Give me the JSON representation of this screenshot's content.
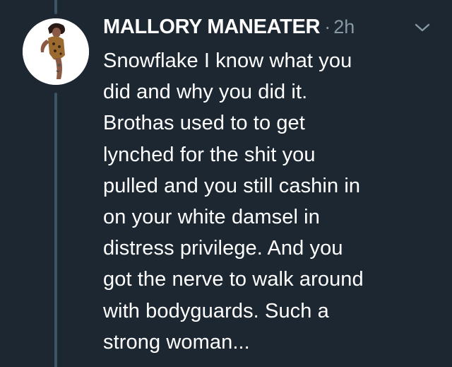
{
  "tweet": {
    "author_name": "MALLORY MANEATER",
    "separator": "·",
    "timestamp": "2h",
    "text": "Snowflake I know what you\ndid and why you did it.\nBrothas used to to get\nlynched for the shit you\npulled and you still cashin in\non your white damsel in\ndistress privilege. And you\ngot the nerve to walk around\nwith bodyguards. Such a\nstrong woman...",
    "menu_icon": "chevron-down-icon",
    "avatar_icon": "avatar"
  },
  "colors": {
    "background": "#1c2732",
    "text": "#ffffff",
    "muted": "#8899a6",
    "thread_line": "#3d5466"
  }
}
